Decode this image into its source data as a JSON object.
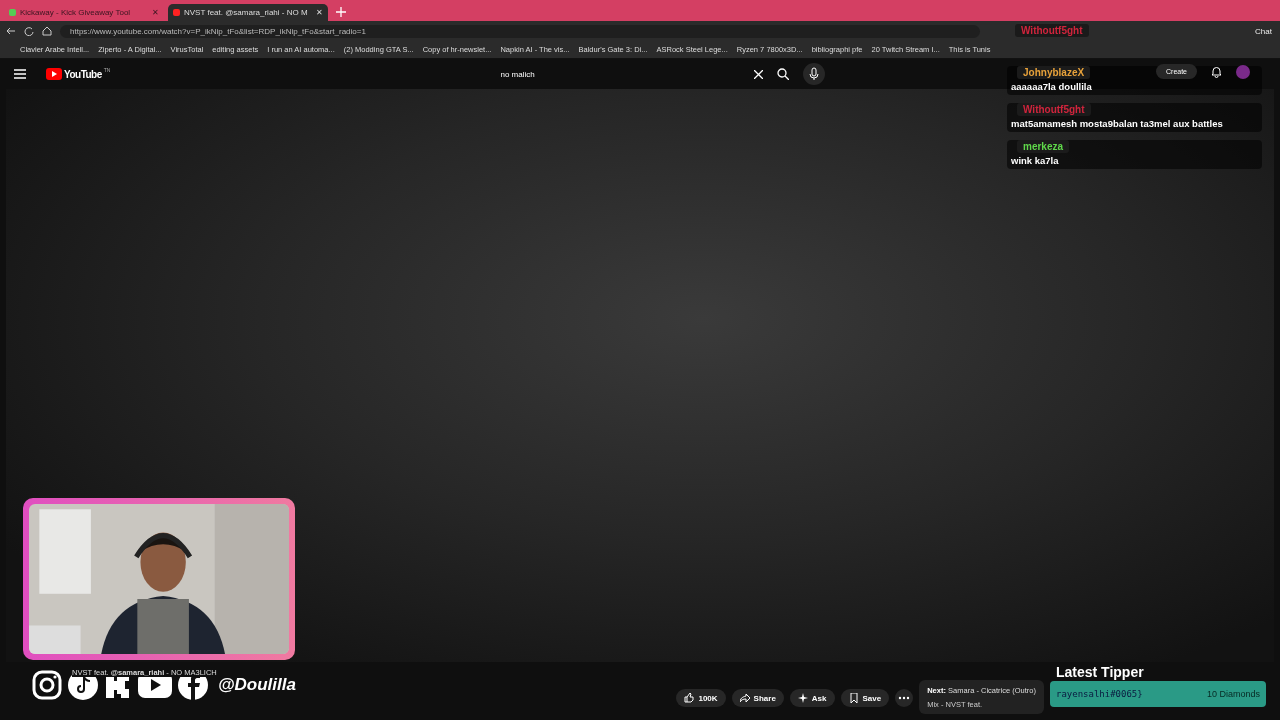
{
  "browser": {
    "tabs": [
      {
        "title": "Kickaway - Kick Giveaway Tool",
        "selected": false
      },
      {
        "title": "NVST feat. @samara_riahi - NO M",
        "selected": true
      }
    ],
    "url": "https://www.youtube.com/watch?v=P_ikNip_tFo&list=RDP_ikNip_tFo&start_radio=1",
    "chat_button": "Chat",
    "tab_close": "✕",
    "bookmarks": [
      "Clavier Arabe Intell...",
      "Ziperto - A Digital...",
      "VirusTotal",
      "editing assets",
      "I run an AI automa...",
      "(2) Modding GTA S...",
      "Copy of hr-newslet...",
      "Napkin AI - The vis...",
      "Baldur's Gate 3: Di...",
      "ASRock Steel Lege...",
      "Ryzen 7 7800x3D...",
      "bibliographi pfe",
      "20 Twitch Stream I...",
      "This is Tunis"
    ]
  },
  "youtube": {
    "logo": "YouTube",
    "logo_suffix": "TN",
    "search": "no malich",
    "create": "Create",
    "video_title": "NVST feat. **@samara_riahi** - NO MA3LICH",
    "actions": [
      {
        "kind": "like",
        "label": "100K"
      },
      {
        "kind": "share",
        "label": "Share"
      },
      {
        "kind": "ask",
        "label": "Ask"
      },
      {
        "kind": "save",
        "label": "Save"
      }
    ],
    "next": {
      "label": "Next:",
      "title": "Samara - Cicatrice (Outro)",
      "mix": "Mix - NVST feat."
    }
  },
  "overlay": {
    "top_user": {
      "name": "Withoutf5ght",
      "color": "#d0243c"
    },
    "chat": [
      {
        "user": "JohnyblazeX",
        "color": "#e8a23a",
        "text": "aaaaaa7la doullila"
      },
      {
        "user": "Withoutf5ght",
        "color": "#d0243c",
        "text": "mat5amamesh mosta9balan ta3mel aux battles"
      },
      {
        "user": "merkeza",
        "color": "#5fd84a",
        "text": "wink ka7la"
      }
    ],
    "social_handle": "@Doulilla",
    "tipper": {
      "title": "Latest Tipper",
      "name": "rayensalhi#0065}",
      "amount": "10 Diamonds"
    }
  }
}
